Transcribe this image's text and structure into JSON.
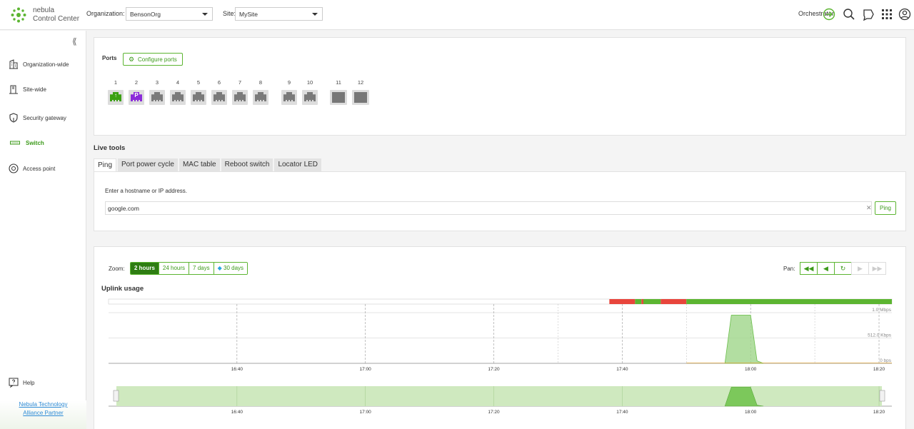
{
  "brand": {
    "line1": "nebula",
    "line2": "Control Center"
  },
  "header": {
    "org_label": "Organization:",
    "org_value": "BensonOrg",
    "site_label": "Site:",
    "site_value": "MySite",
    "orchestrator": "Orchestrator"
  },
  "sidebar": {
    "items": [
      {
        "label": "Organization-wide",
        "icon": "building-icon"
      },
      {
        "label": "Site-wide",
        "icon": "site-icon"
      },
      {
        "label": "Security gateway",
        "icon": "shield-icon"
      },
      {
        "label": "Switch",
        "icon": "switch-icon"
      },
      {
        "label": "Access point",
        "icon": "access-point-icon"
      }
    ],
    "active": "Switch",
    "help": "Help",
    "partner_line1": "Nebula Technology",
    "partner_line2": "Alliance Partner"
  },
  "ports": {
    "title": "Ports",
    "configure_label": "Configure ports",
    "items": [
      {
        "num": "1",
        "status": "uplink"
      },
      {
        "num": "2",
        "status": "poe",
        "symbol": "P"
      },
      {
        "num": "3",
        "status": "idle"
      },
      {
        "num": "4",
        "status": "idle"
      },
      {
        "num": "5",
        "status": "idle"
      },
      {
        "num": "6",
        "status": "idle"
      },
      {
        "num": "7",
        "status": "idle"
      },
      {
        "num": "8",
        "status": "idle"
      },
      {
        "num": "9",
        "status": "idle"
      },
      {
        "num": "10",
        "status": "idle"
      },
      {
        "num": "11",
        "status": "sfp"
      },
      {
        "num": "12",
        "status": "sfp"
      }
    ]
  },
  "live_tools": {
    "title": "Live tools",
    "tabs": [
      "Ping",
      "Port power cycle",
      "MAC table",
      "Reboot switch",
      "Locator LED"
    ],
    "active_tab": "Ping",
    "hint": "Enter a hostname or IP address.",
    "input_value": "google.com",
    "ping_label": "Ping"
  },
  "usage": {
    "zoom_label": "Zoom:",
    "zoom_options": [
      "2 hours",
      "24 hours",
      "7 days",
      "30 days"
    ],
    "zoom_active": "2 hours",
    "pan_label": "Pan:",
    "title": "Uplink usage"
  },
  "chart_data": {
    "type": "area",
    "title": "Uplink usage",
    "x_ticks": [
      "16:40",
      "17:00",
      "17:20",
      "17:40",
      "18:00",
      "18:20"
    ],
    "y_ticks": [
      "1.0 Mbps",
      "512.0 Kbps",
      "0 bps"
    ],
    "ylim": [
      0,
      1.0
    ],
    "series": [
      {
        "color": "#9fd68a",
        "x": [
          "17:56",
          "17:57",
          "18:00",
          "18:01",
          "18:02"
        ],
        "values": [
          0,
          0.95,
          0.95,
          0.05,
          0
        ]
      }
    ],
    "status_bar": [
      {
        "from": "16:20",
        "to": "17:38",
        "status": "none",
        "color": "#ffffff"
      },
      {
        "from": "17:38",
        "to": "17:42",
        "status": "down",
        "color": "#e8453c"
      },
      {
        "from": "17:42",
        "to": "17:43",
        "status": "up",
        "color": "#5cb531"
      },
      {
        "from": "17:43",
        "to": "17:43.3",
        "status": "down",
        "color": "#e8453c"
      },
      {
        "from": "17:43.3",
        "to": "17:46",
        "status": "up",
        "color": "#5cb531"
      },
      {
        "from": "17:46",
        "to": "17:50",
        "status": "down",
        "color": "#e8453c"
      },
      {
        "from": "17:50",
        "to": "18:22",
        "status": "up",
        "color": "#5cb531"
      }
    ]
  },
  "colors": {
    "accent": "#3c9a1a",
    "accent_light": "#5cb531",
    "down": "#e8453c"
  }
}
